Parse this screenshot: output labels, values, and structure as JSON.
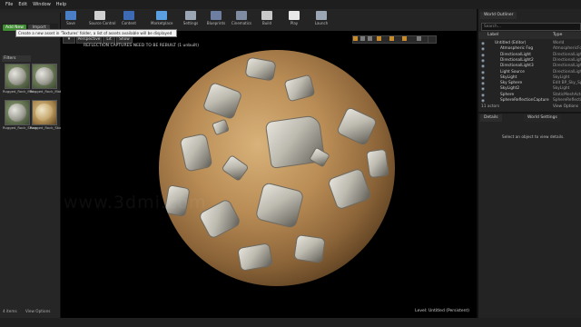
{
  "menu": [
    "File",
    "Edit",
    "Window",
    "Help"
  ],
  "toolbar": [
    {
      "label": "Save",
      "color": "#4a7fc6"
    },
    {
      "label": "Source Control",
      "color": "#d0d0d0"
    },
    {
      "label": "Content",
      "color": "#3d6bb3"
    },
    {
      "label": "Marketplace",
      "color": "#5aa0e0"
    },
    {
      "label": "Settings",
      "color": "#9aa6b4"
    },
    {
      "label": "Blueprints",
      "color": "#6d7ea0"
    },
    {
      "label": "Cinematics",
      "color": "#7e8ba0"
    },
    {
      "label": "Build",
      "color": "#c8c8c8"
    },
    {
      "label": "Play",
      "color": "#e8e8e8"
    },
    {
      "label": "Launch",
      "color": "#9aa6b4"
    }
  ],
  "left_panel": {
    "add_new_label": "Add New",
    "import_label": "Import",
    "filters_label": "Filters",
    "tooltip": "Create a new asset in 'Textures' folder, a list of assets available will be displayed",
    "items": [
      "Rugged_Rock_Mat",
      "Rugged_Rock_Mat2",
      "Rugged_Rock_Sharp",
      "Rugged_Rock_Stone"
    ],
    "item_count": "4 items",
    "view_options": "View Options"
  },
  "viewport": {
    "perspective_label": "Perspective",
    "lit_label": "Lit",
    "show_label": "Show",
    "notice": "REFLECTION CAPTURES NEED TO BE REBUILT (1 unbuilt)",
    "status": "Level: Untitled (Persistent)",
    "watermark": "www.3dmi.com"
  },
  "world_outliner": {
    "tab_label": "World Outliner",
    "search_placeholder": "Search...",
    "col_label": "Label",
    "col_type": "Type",
    "rows": [
      {
        "name": "Untitled (Editor)",
        "type": "World",
        "visible": true
      },
      {
        "name": "Atmospheric Fog",
        "type": "AtmosphericFog",
        "visible": true
      },
      {
        "name": "DirectionalLight",
        "type": "DirectionalLight",
        "visible": true
      },
      {
        "name": "DirectionalLight2",
        "type": "DirectionalLight",
        "visible": true
      },
      {
        "name": "DirectionalLight3",
        "type": "DirectionalLight",
        "visible": true
      },
      {
        "name": "Light Source",
        "type": "DirectionalLight",
        "visible": true
      },
      {
        "name": "SkyLight",
        "type": "SkyLight",
        "visible": true
      },
      {
        "name": "Sky Sphere",
        "type": "Edit BP_Sky_Sp",
        "visible": true
      },
      {
        "name": "SkyLight2",
        "type": "SkyLight",
        "visible": true
      },
      {
        "name": "Sphere",
        "type": "StaticMeshActor",
        "visible": true
      },
      {
        "name": "SphereReflectionCapture",
        "type": "SphereReflectionCap",
        "visible": true
      }
    ],
    "actor_count": "11 actors",
    "view_options": "View Options"
  },
  "details": {
    "tab_label": "Details",
    "world_settings_tab": "World Settings",
    "empty_text": "Select an object to view details."
  }
}
